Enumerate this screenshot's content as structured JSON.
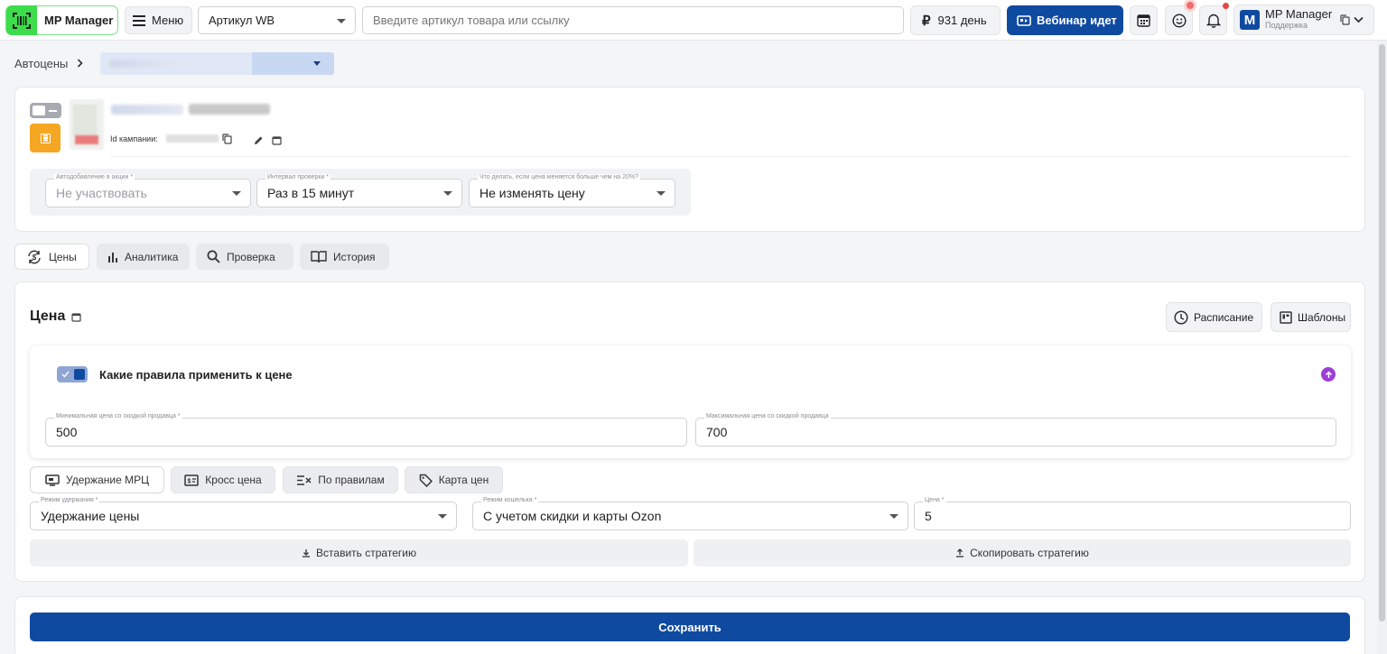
{
  "topbar": {
    "logo_text": "MP Manager",
    "menu_label": "Меню",
    "article_select": "Артикул WB",
    "search_placeholder": "Введите артикул товара или ссылку",
    "balance": "931 день",
    "webinar": "Вебинар идет",
    "account_name": "MP Manager",
    "account_sub": "Поддержка",
    "account_initial": "M"
  },
  "breadcrumb": {
    "root": "Автоцены"
  },
  "campaign": {
    "id_label": "Id кампании:",
    "fields": [
      {
        "label": "Автодобавление в акции *",
        "value": "Не участвовать"
      },
      {
        "label": "Интервал проверки *",
        "value": "Раз в 15 минут"
      },
      {
        "label": "Что делать, если цена меняется больше чем на 20%?",
        "value": "Не изменять цену"
      }
    ]
  },
  "tabs": [
    "Цены",
    "Аналитика",
    "Проверка",
    "История"
  ],
  "price": {
    "title": "Цена",
    "schedule_button": "Расписание",
    "templates_button": "Шаблоны",
    "rules_title": "Какие правила применить к цене",
    "min_label": "Минимальная цена со скидкой продавца *",
    "min_value": "500",
    "max_label": "Максимальная цена со скидкой продавца",
    "max_value": "700",
    "strategy_tabs": [
      "Удержание МРЦ",
      "Кросс цена",
      "По правилам",
      "Карта цен"
    ],
    "hold_mode_label": "Режим удержания *",
    "hold_mode_value": "Удержание цены",
    "wallet_mode_label": "Режим кошелька *",
    "wallet_mode_value": "С учетом скидки и карты Ozon",
    "price_label": "Цена *",
    "price_value": "5",
    "paste_strategy": "Вставить стратегию",
    "copy_strategy": "Скопировать стратегию"
  },
  "save_button": "Сохранить",
  "colors": {
    "brand_blue": "#0f4aa1",
    "logo_green": "#3ddc4a",
    "orange": "#f5a623",
    "purple": "#9c3fd6"
  }
}
